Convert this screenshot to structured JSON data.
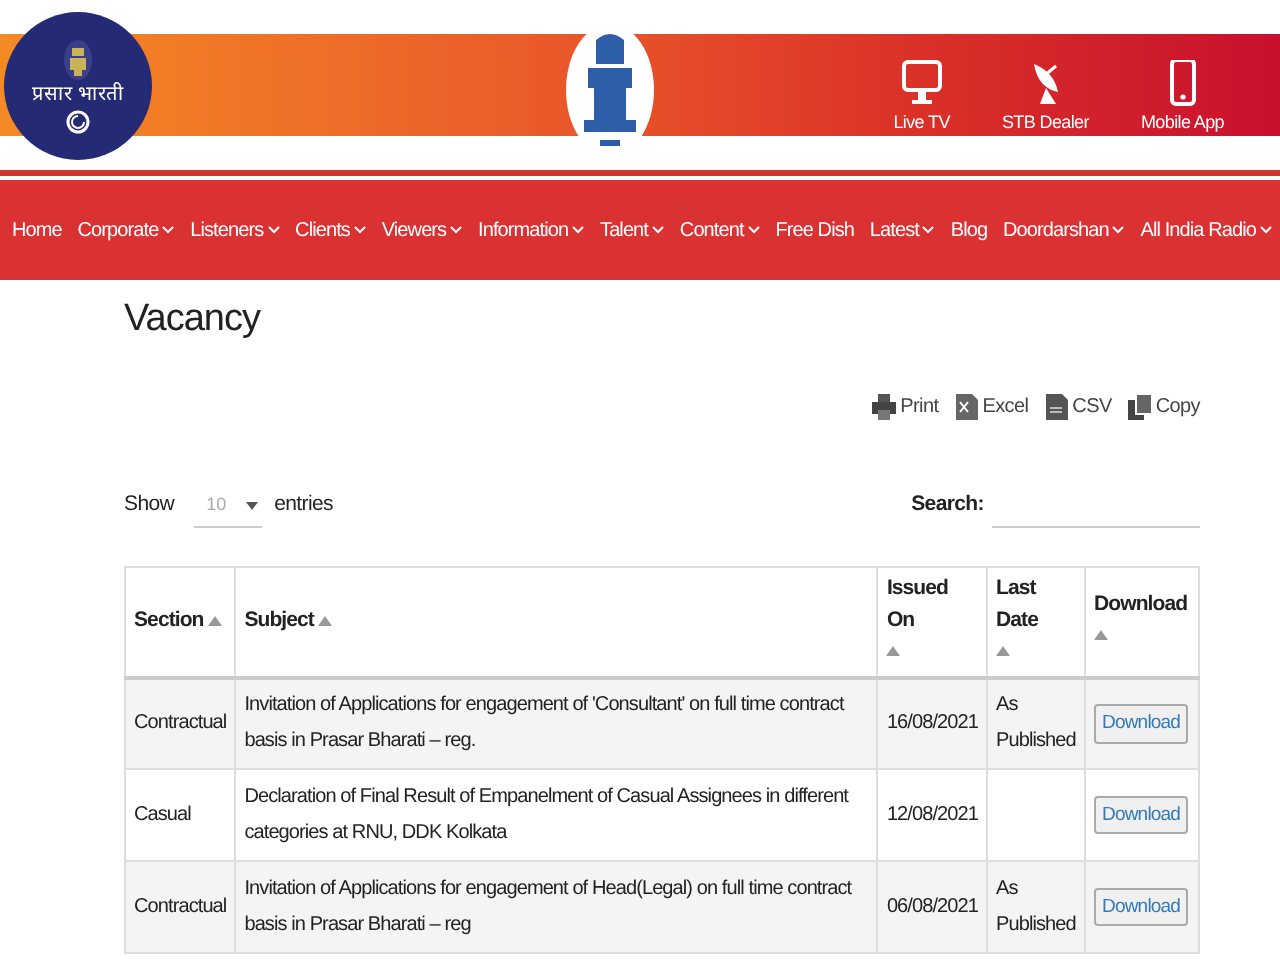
{
  "logo": {
    "text": "प्रसार भारती"
  },
  "quick_links": [
    {
      "label": "Live TV",
      "kind": "tv"
    },
    {
      "label": "STB Dealer",
      "kind": "dish"
    },
    {
      "label": "Mobile App",
      "kind": "phone"
    }
  ],
  "nav": [
    {
      "label": "Home",
      "dropdown": false
    },
    {
      "label": "Corporate",
      "dropdown": true
    },
    {
      "label": "Listeners",
      "dropdown": true
    },
    {
      "label": "Clients",
      "dropdown": true
    },
    {
      "label": "Viewers",
      "dropdown": true
    },
    {
      "label": "Information",
      "dropdown": true
    },
    {
      "label": "Talent",
      "dropdown": true
    },
    {
      "label": "Content",
      "dropdown": true
    },
    {
      "label": "Free Dish",
      "dropdown": false
    },
    {
      "label": "Latest",
      "dropdown": true
    },
    {
      "label": "Blog",
      "dropdown": false
    },
    {
      "label": "Doordarshan",
      "dropdown": true
    },
    {
      "label": "All India Radio",
      "dropdown": true
    }
  ],
  "page_title": "Vacancy",
  "export_buttons": [
    {
      "label": "Print",
      "kind": "print"
    },
    {
      "label": "Excel",
      "kind": "excel"
    },
    {
      "label": "CSV",
      "kind": "csv"
    },
    {
      "label": "Copy",
      "kind": "copy"
    }
  ],
  "length_menu": {
    "before": "Show",
    "value": "10",
    "after": "entries"
  },
  "search": {
    "label": "Search:"
  },
  "table": {
    "columns": [
      {
        "label": "Section",
        "sortable": true
      },
      {
        "label": "Subject",
        "sortable": true
      },
      {
        "label": "Issued On",
        "sortable": true
      },
      {
        "label": "Last Date",
        "sortable": true
      },
      {
        "label": "Download",
        "sortable": true
      }
    ],
    "rows": [
      {
        "section": "Contractual",
        "subject": "Invitation of Applications for engagement of 'Consultant' on full time contract basis in Prasar Bharati – reg.",
        "issued_on": "16/08/2021",
        "last_date": "As Published",
        "download": "Download"
      },
      {
        "section": "Casual",
        "subject": "Declaration of Final Result of Empanelment of Casual Assignees in different categories at RNU, DDK Kolkata",
        "issued_on": "12/08/2021",
        "download": "Download"
      },
      {
        "section": "Contractual",
        "subject": "Invitation of Applications for engagement of Head(Legal) on full time contract basis in Prasar Bharati – reg",
        "issued_on": "06/08/2021",
        "last_date": "As Published",
        "download": "Download"
      }
    ]
  }
}
